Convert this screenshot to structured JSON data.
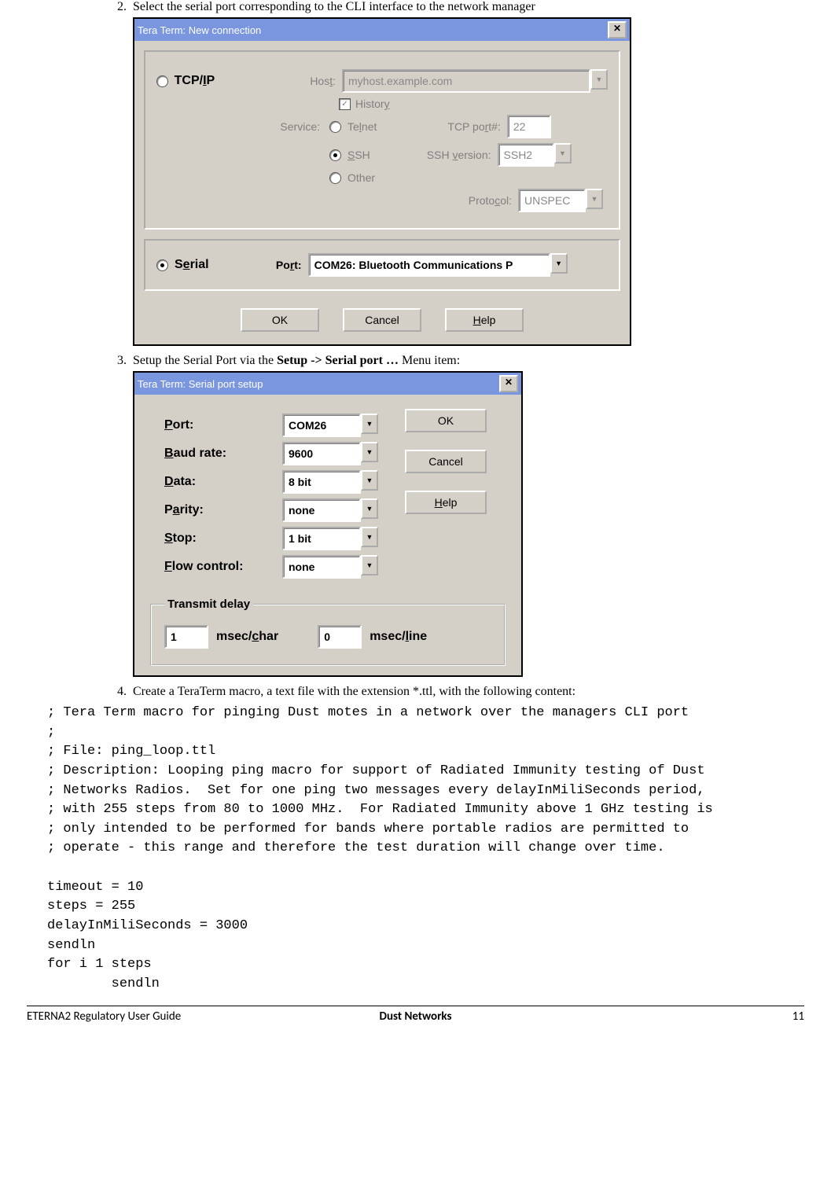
{
  "steps": {
    "s2": {
      "num": "2.",
      "text": "Select the serial port corresponding to the CLI interface to the network manager"
    },
    "s3": {
      "num": "3.",
      "pre": "Setup the Serial Port via the ",
      "bold": "Setup -> Serial port …",
      "post": " Menu item:"
    },
    "s4": {
      "num": "4.",
      "text": "Create a TeraTerm macro, a text file with the extension *.ttl, with the following content:"
    }
  },
  "dlg1": {
    "title": "Tera Term: New connection",
    "tcpip": "TCP/IP",
    "host_label": "Host:",
    "host_value": "myhost.example.com",
    "history": "History",
    "service_label": "Service:",
    "telnet": "Telnet",
    "ssh": "SSH",
    "other": "Other",
    "tcpport_label": "TCP port#:",
    "tcpport_value": "22",
    "sshver_label": "SSH version:",
    "sshver_value": "SSH2",
    "proto_label": "Protocol:",
    "proto_value": "UNSPEC",
    "serial": "Serial",
    "port_label": "Port:",
    "port_value": "COM26: Bluetooth Communications P",
    "ok": "OK",
    "cancel": "Cancel",
    "help": "Help"
  },
  "dlg2": {
    "title": "Tera Term: Serial port setup",
    "port_l": "Port:",
    "port_v": "COM26",
    "baud_l": "Baud rate:",
    "baud_v": "9600",
    "data_l": "Data:",
    "data_v": "8 bit",
    "parity_l": "Parity:",
    "parity_v": "none",
    "stop_l": "Stop:",
    "stop_v": "1 bit",
    "flow_l": "Flow control:",
    "flow_v": "none",
    "ok": "OK",
    "cancel": "Cancel",
    "help": "Help",
    "tx_legend": "Transmit delay",
    "tx_char_v": "1",
    "tx_char_l": "msec/char",
    "tx_line_v": "0",
    "tx_line_l": "msec/line"
  },
  "code": "; Tera Term macro for pinging Dust motes in a network over the managers CLI port\n;\n; File: ping_loop.ttl\n; Description: Looping ping macro for support of Radiated Immunity testing of Dust\n; Networks Radios.  Set for one ping two messages every delayInMiliSeconds period,\n; with 255 steps from 80 to 1000 MHz.  For Radiated Immunity above 1 GHz testing is\n; only intended to be performed for bands where portable radios are permitted to\n; operate - this range and therefore the test duration will change over time.\n\ntimeout = 10\nsteps = 255\ndelayInMiliSeconds = 3000\nsendln\nfor i 1 steps\n        sendln",
  "footer": {
    "left": "ETERNA2 Regulatory User Guide",
    "center": "Dust Networks",
    "right": "11"
  }
}
